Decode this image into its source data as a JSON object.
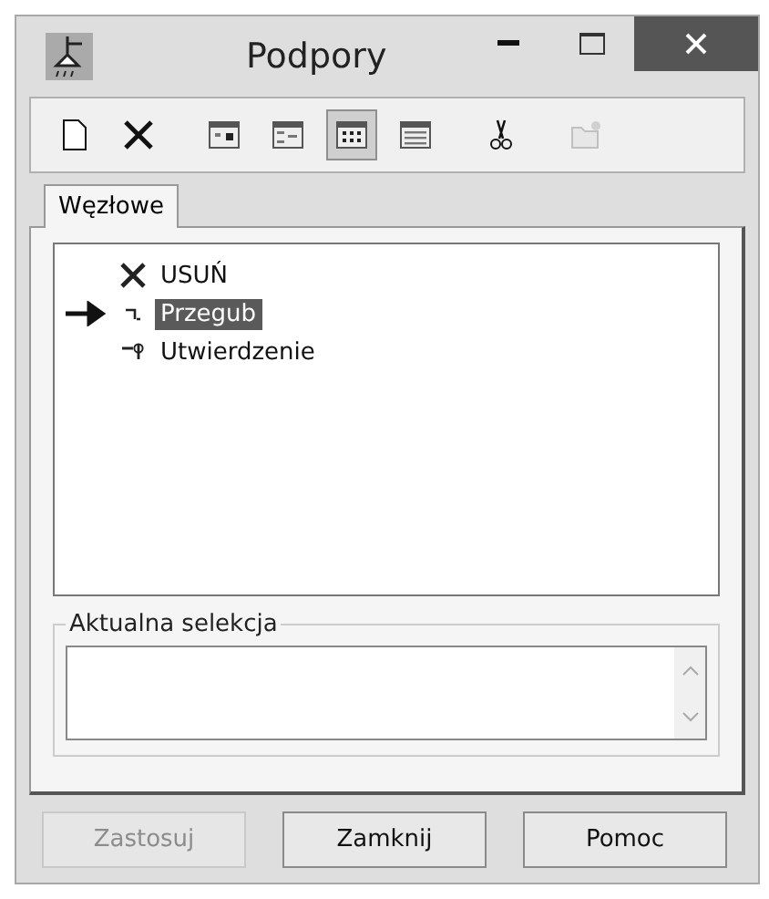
{
  "window": {
    "title": "Podpory"
  },
  "toolbar": [
    {
      "kind": "new",
      "selected": false,
      "disabled": false
    },
    {
      "kind": "delete",
      "selected": false,
      "disabled": false
    },
    {
      "kind": "view-a",
      "selected": false,
      "disabled": false
    },
    {
      "kind": "view-b",
      "selected": false,
      "disabled": false
    },
    {
      "kind": "view-c",
      "selected": true,
      "disabled": false
    },
    {
      "kind": "view-d",
      "selected": false,
      "disabled": false
    },
    {
      "kind": "cut",
      "selected": false,
      "disabled": false
    },
    {
      "kind": "folder",
      "selected": false,
      "disabled": true
    }
  ],
  "tabs": [
    {
      "label": "Węzłowe",
      "selected": true
    }
  ],
  "tree": [
    {
      "kind": "delete",
      "label": "USUŃ",
      "selected": false,
      "current": false
    },
    {
      "kind": "hinge",
      "label": "Przegub",
      "selected": true,
      "current": true
    },
    {
      "kind": "fixed",
      "label": "Utwierdzenie",
      "selected": false,
      "current": false
    }
  ],
  "selection_group": {
    "label": "Aktualna selekcja"
  },
  "buttons": [
    {
      "label": "Zastosuj",
      "disabled": true
    },
    {
      "label": "Zamknij",
      "disabled": false
    },
    {
      "label": "Pomoc",
      "disabled": false
    }
  ]
}
